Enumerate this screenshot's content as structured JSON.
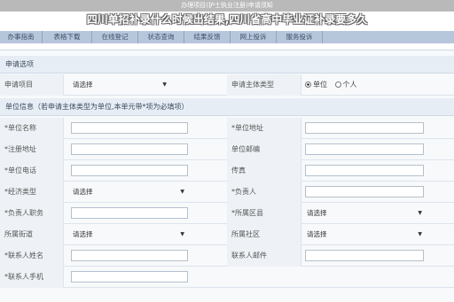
{
  "header": {
    "banner_title": "办理项目(护士执业注册)申请须知",
    "overlay_title": "四川单招补录什么时候出结果,四川省高中毕业证补录要多久"
  },
  "tabs": [
    "办事指南",
    "表格下载",
    "在线登记",
    "状态查询",
    "结果反馈",
    "网上投诉",
    "服务投诉"
  ],
  "form": {
    "section_apply": "申请选项",
    "apply_item_label": "申请项目",
    "apply_item_value": "请选择",
    "subject_type_label": "申请主体类型",
    "radio_unit": "单位",
    "radio_person": "个人",
    "section_unit": "单位信息（若申请主体类型为单位,本单元带*项为必填项）",
    "unit_name": "*单位名称",
    "unit_address": "*单位地址",
    "reg_address": "*注册地址",
    "unit_postcode": "单位邮编",
    "unit_phone": "*单位电话",
    "fax": "传真",
    "economy_type": "*经济类型",
    "economy_value": "请选择",
    "person_in_charge": "*负责人",
    "person_position": "*负责人职务",
    "district": "*所属区县",
    "district_value": "请选择",
    "street": "所属街道",
    "street_value": "请选择",
    "community": "所属社区",
    "community_value": "请选择",
    "contact_name": "*联系人姓名",
    "contact_email": "联系人邮件",
    "contact_mobile": "*联系人手机"
  },
  "colors": {
    "tab_bar": "#b7c7db",
    "section_bg": "#e7edf4",
    "label_bg": "#eef2f6"
  }
}
